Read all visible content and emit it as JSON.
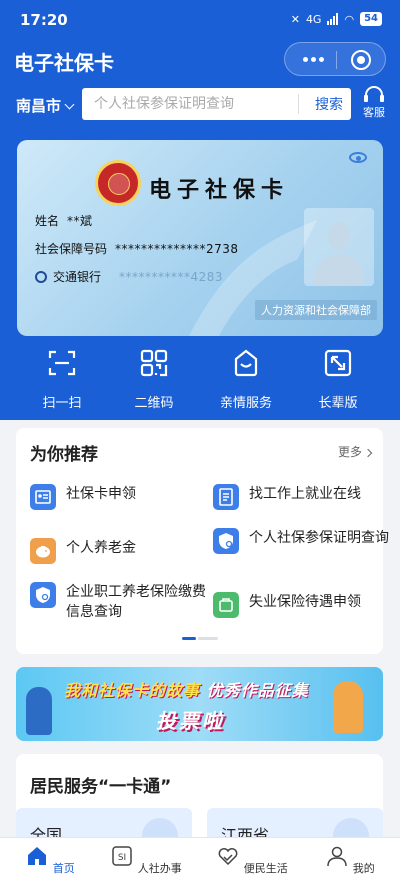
{
  "status_bar": {
    "time": "17:20",
    "network": "4G",
    "battery": "54"
  },
  "header": {
    "title": "电子社保卡"
  },
  "search": {
    "city": "南昌市",
    "placeholder": "个人社保参保证明查询",
    "button": "搜索",
    "service_label": "客服"
  },
  "card": {
    "title": "电子社保卡",
    "name_label": "姓名",
    "name_value": "**斌",
    "number_label": "社会保障号码",
    "number_value": "**************2738",
    "bank_label": "交通银行",
    "bank_value": "***********4283",
    "issuer": "人力资源和社会保障部"
  },
  "quick_actions": [
    {
      "label": "扫一扫",
      "icon": "scan-icon"
    },
    {
      "label": "二维码",
      "icon": "qrcode-icon"
    },
    {
      "label": "亲情服务",
      "icon": "family-service-icon"
    },
    {
      "label": "长辈版",
      "icon": "elder-mode-icon"
    }
  ],
  "recommend": {
    "title": "为你推荐",
    "more": "更多",
    "items": [
      {
        "label": "社保卡申领",
        "icon": "id-card-icon",
        "color": "#3d7ee8"
      },
      {
        "label": "找工作上就业在线",
        "icon": "document-icon",
        "color": "#3d7ee8"
      },
      {
        "label": "个人养老金",
        "icon": "piggy-bank-icon",
        "color": "#f0a04b"
      },
      {
        "label": "个人社保参保证明查询",
        "icon": "certificate-search-icon",
        "color": "#3d7ee8"
      },
      {
        "label": "企业职工养老保险缴费信息查询",
        "icon": "shield-search-icon",
        "color": "#3d7ee8"
      },
      {
        "label": "失业保险待遇申领",
        "icon": "unemployment-icon",
        "color": "#4cbb6c"
      }
    ]
  },
  "banner": {
    "line1_a": "我和社保卡的故事",
    "line1_b": "优秀作品征集",
    "line2": "投票啦"
  },
  "residents": {
    "title": "居民服务“一卡通”",
    "tiles": [
      "全国",
      "江西省"
    ]
  },
  "bottom_nav": [
    {
      "label": "首页",
      "icon": "home-icon",
      "active": true
    },
    {
      "label": "人社办事",
      "icon": "si-icon",
      "active": false
    },
    {
      "label": "便民生活",
      "icon": "heart-hand-icon",
      "active": false
    },
    {
      "label": "我的",
      "icon": "user-icon",
      "active": false
    }
  ],
  "colors": {
    "primary": "#1a5fd6",
    "background": "#f2f3f7"
  }
}
